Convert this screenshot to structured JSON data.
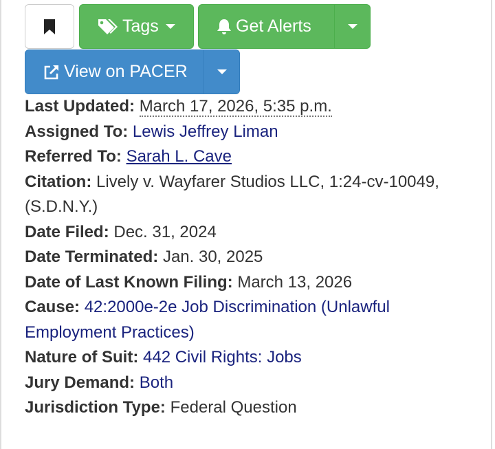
{
  "buttons": {
    "tags_label": "Tags",
    "alerts_label": "Get Alerts",
    "pacer_label": "View on PACER"
  },
  "details": {
    "last_updated": {
      "label": "Last Updated:",
      "value": "March 17, 2026, 5:35 p.m."
    },
    "assigned_to": {
      "label": "Assigned To:",
      "value": "Lewis Jeffrey Liman"
    },
    "referred_to": {
      "label": "Referred To:",
      "value": "Sarah L. Cave"
    },
    "citation": {
      "label": "Citation:",
      "value": "Lively v. Wayfarer Studios LLC, 1:24-cv-10049, (S.D.N.Y.)"
    },
    "date_filed": {
      "label": "Date Filed:",
      "value": "Dec. 31, 2024"
    },
    "date_terminated": {
      "label": "Date Terminated:",
      "value": "Jan. 30, 2025"
    },
    "last_known_filing": {
      "label": "Date of Last Known Filing:",
      "value": "March 13, 2026"
    },
    "cause": {
      "label": "Cause:",
      "value": "42:2000e-2e Job Discrimination (Unlawful Employment Practices)"
    },
    "nature_of_suit": {
      "label": "Nature of Suit:",
      "value": "442 Civil Rights: Jobs"
    },
    "jury_demand": {
      "label": "Jury Demand:",
      "value": "Both"
    },
    "jurisdiction_type": {
      "label": "Jurisdiction Type:",
      "value": "Federal Question"
    }
  },
  "icons": {
    "bookmark": "bookmark-icon",
    "tags": "tags-icon",
    "alerts": "bell-icon",
    "pacer": "external-link-icon",
    "caret": "caret-down-icon"
  },
  "colors": {
    "green": "#5cb85c",
    "blue": "#428bca",
    "link": "#1a237e",
    "text": "#333333"
  }
}
